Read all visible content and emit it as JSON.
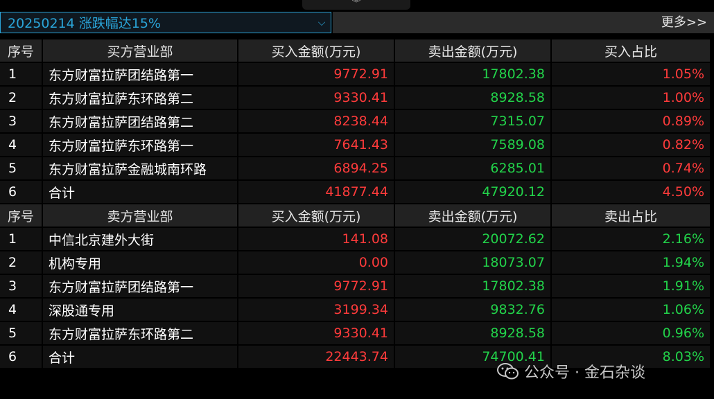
{
  "collapse_glyph": "︾",
  "selector": {
    "text": "20250214  涨跌幅达15%",
    "chevron": "⌵"
  },
  "more_label": "更多>>",
  "buy_section": {
    "headers": [
      "序号",
      "买方营业部",
      "买入金额(万元)",
      "卖出金额(万元)",
      "买入占比"
    ],
    "rows": [
      {
        "idx": "1",
        "name": "东方财富拉萨团结路第一",
        "buy": "9772.91",
        "sell": "17802.38",
        "ratio": "1.05%"
      },
      {
        "idx": "2",
        "name": "东方财富拉萨东环路第二",
        "buy": "9330.41",
        "sell": "8928.58",
        "ratio": "1.00%"
      },
      {
        "idx": "3",
        "name": "东方财富拉萨团结路第二",
        "buy": "8238.44",
        "sell": "7315.07",
        "ratio": "0.89%"
      },
      {
        "idx": "4",
        "name": "东方财富拉萨东环路第一",
        "buy": "7641.43",
        "sell": "7589.08",
        "ratio": "0.82%"
      },
      {
        "idx": "5",
        "name": "东方财富拉萨金融城南环路",
        "buy": "6894.25",
        "sell": "6285.01",
        "ratio": "0.74%"
      },
      {
        "idx": "6",
        "name": "合计",
        "buy": "41877.44",
        "sell": "47920.12",
        "ratio": "4.50%"
      }
    ]
  },
  "sell_section": {
    "headers": [
      "序号",
      "卖方营业部",
      "买入金额(万元)",
      "卖出金额(万元)",
      "卖出占比"
    ],
    "rows": [
      {
        "idx": "1",
        "name": "中信北京建外大街",
        "buy": "141.08",
        "sell": "20072.62",
        "ratio": "2.16%"
      },
      {
        "idx": "2",
        "name": "机构专用",
        "buy": "0.00",
        "sell": "18073.07",
        "ratio": "1.94%"
      },
      {
        "idx": "3",
        "name": "东方财富拉萨团结路第一",
        "buy": "9772.91",
        "sell": "17802.38",
        "ratio": "1.91%"
      },
      {
        "idx": "4",
        "name": "深股通专用",
        "buy": "3199.34",
        "sell": "9832.76",
        "ratio": "1.06%"
      },
      {
        "idx": "5",
        "name": "东方财富拉萨东环路第二",
        "buy": "9330.41",
        "sell": "8928.58",
        "ratio": "0.96%"
      },
      {
        "idx": "6",
        "name": "合计",
        "buy": "22443.74",
        "sell": "74700.41",
        "ratio": "8.03%"
      }
    ]
  },
  "colors": {
    "buy": "#ff3b3b",
    "sell": "#22d34a",
    "accent": "#2aa4d8"
  },
  "watermark": {
    "text": "公众号 · 金石杂谈",
    "icon": "wechat-icon"
  }
}
